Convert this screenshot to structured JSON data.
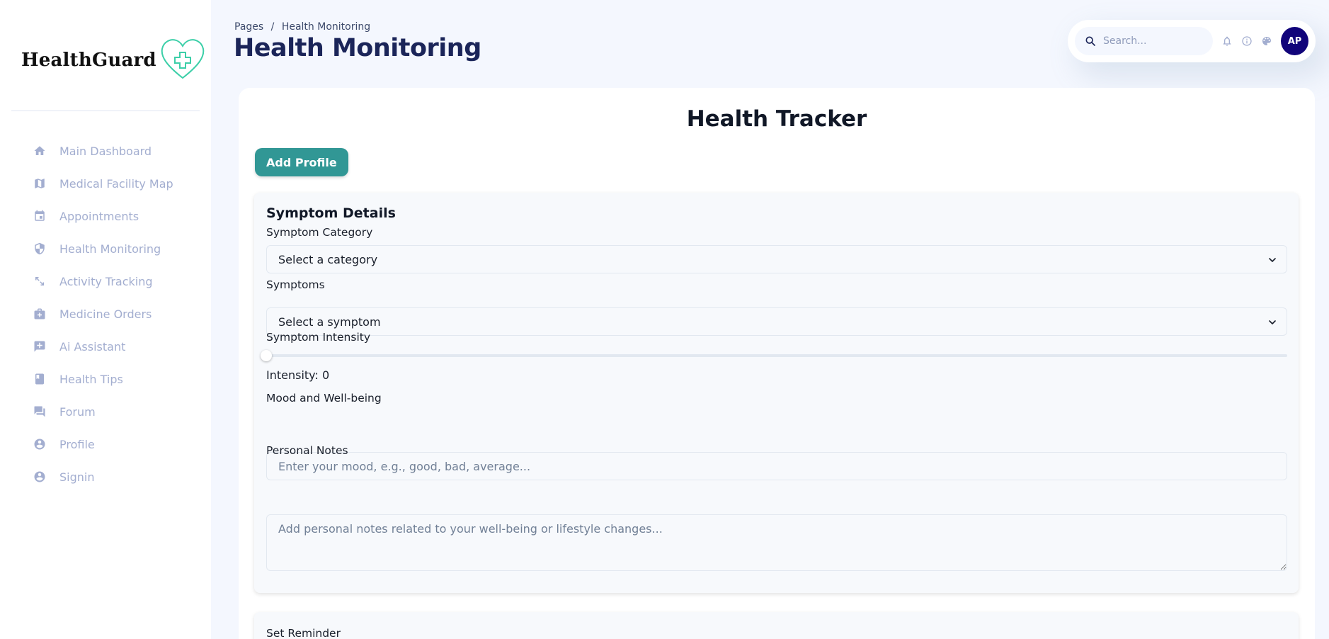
{
  "sidebar": {
    "brand": "HealthGuard",
    "items": [
      {
        "label": "Main Dashboard",
        "icon": "home-icon"
      },
      {
        "label": "Medical Facility Map",
        "icon": "map-icon"
      },
      {
        "label": "Appointments",
        "icon": "calendar-icon"
      },
      {
        "label": "Health Monitoring",
        "icon": "shield-icon"
      },
      {
        "label": "Activity Tracking",
        "icon": "expand-arrows-icon"
      },
      {
        "label": "Medicine Orders",
        "icon": "medical-bag-icon"
      },
      {
        "label": "Ai Assistant",
        "icon": "chat-plus-icon"
      },
      {
        "label": "Health Tips",
        "icon": "book-icon"
      },
      {
        "label": "Forum",
        "icon": "forum-icon"
      },
      {
        "label": "Profile",
        "icon": "user-circle-icon"
      },
      {
        "label": "Signin",
        "icon": "user-circle-icon"
      }
    ]
  },
  "header": {
    "breadcrumb_root": "Pages",
    "breadcrumb_sep": "/",
    "breadcrumb_current": "Health Monitoring",
    "title": "Health Monitoring",
    "search_placeholder": "Search...",
    "avatar_initials": "AP"
  },
  "main": {
    "card_title": "Health Tracker",
    "add_profile_label": "Add Profile",
    "symptom_section": {
      "title": "Symptom Details",
      "category_label": "Symptom Category",
      "category_value": "Select a category",
      "symptoms_label": "Symptoms",
      "symptoms_value": "Select a symptom",
      "intensity_label": "Symptom Intensity",
      "intensity_level": 0,
      "intensity_text": "Intensity: 0",
      "mood_label": "Mood and Well-being",
      "mood_placeholder": "Enter your mood, e.g., good, bad, average...",
      "notes_label": "Personal Notes",
      "notes_placeholder": "Add personal notes related to your well-being or lifestyle changes..."
    },
    "reminder_label": "Set Reminder"
  },
  "colors": {
    "accent": "#319795",
    "avatar_bg": "#11047a",
    "title": "#1b2559",
    "nav": "#a3aed0"
  }
}
